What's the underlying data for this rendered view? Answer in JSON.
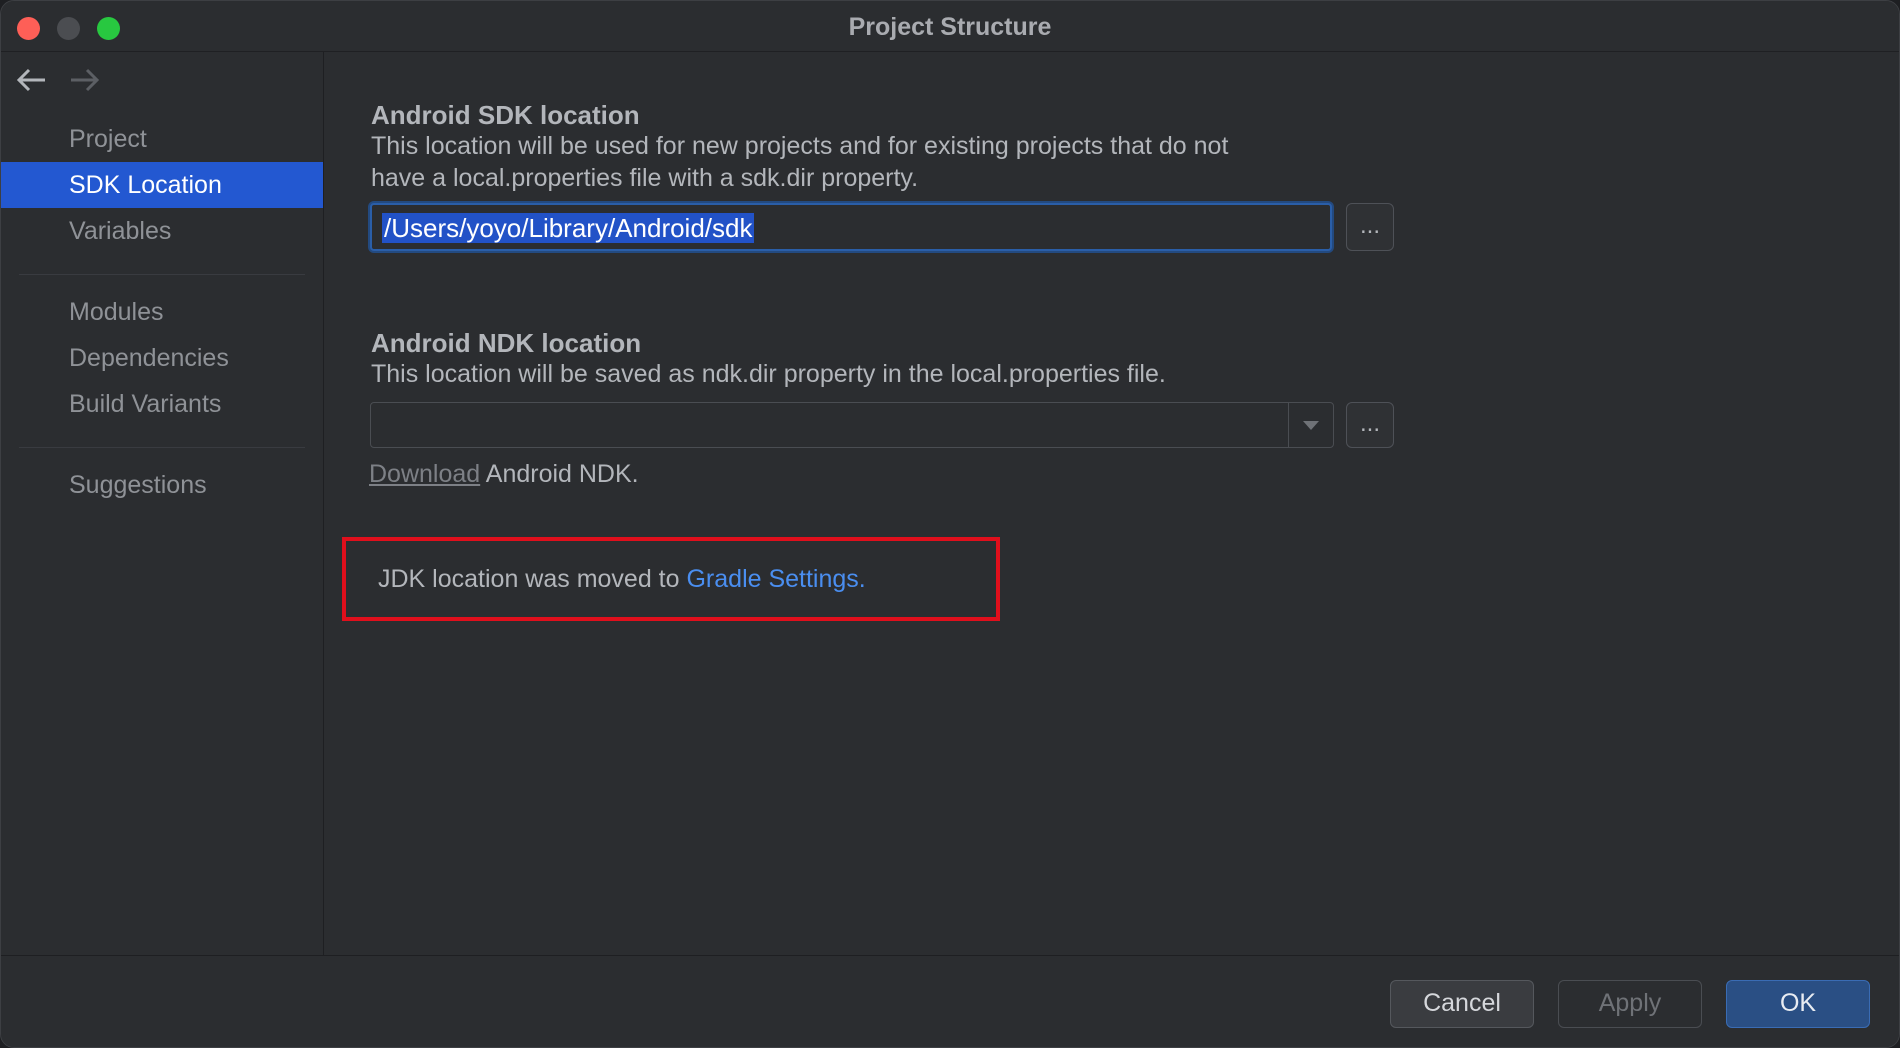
{
  "window": {
    "title": "Project Structure"
  },
  "sidebar": {
    "groups": [
      [
        {
          "label": "Project",
          "selected": false
        },
        {
          "label": "SDK Location",
          "selected": true
        },
        {
          "label": "Variables",
          "selected": false
        }
      ],
      [
        {
          "label": "Modules",
          "selected": false
        },
        {
          "label": "Dependencies",
          "selected": false
        },
        {
          "label": "Build Variants",
          "selected": false
        }
      ],
      [
        {
          "label": "Suggestions",
          "selected": false
        }
      ]
    ]
  },
  "sdk": {
    "title": "Android SDK location",
    "desc_line1": "This location will be used for new projects and for existing projects that do not",
    "desc_line2": "have a local.properties file with a sdk.dir property.",
    "path": "/Users/yoyo/Library/Android/sdk",
    "browse_label": "..."
  },
  "ndk": {
    "title": "Android NDK location",
    "desc": "This location will be saved as ndk.dir property in the local.properties file.",
    "value": "",
    "browse_label": "...",
    "download_link": "Download",
    "download_suffix": "Android NDK."
  },
  "jdk": {
    "text": "JDK location was moved to",
    "link": "Gradle Settings."
  },
  "footer": {
    "cancel": "Cancel",
    "apply": "Apply",
    "ok": "OK"
  },
  "colors": {
    "accent": "#2358d1",
    "link": "#4a8ef0",
    "highlight_border": "#e00f1c"
  }
}
